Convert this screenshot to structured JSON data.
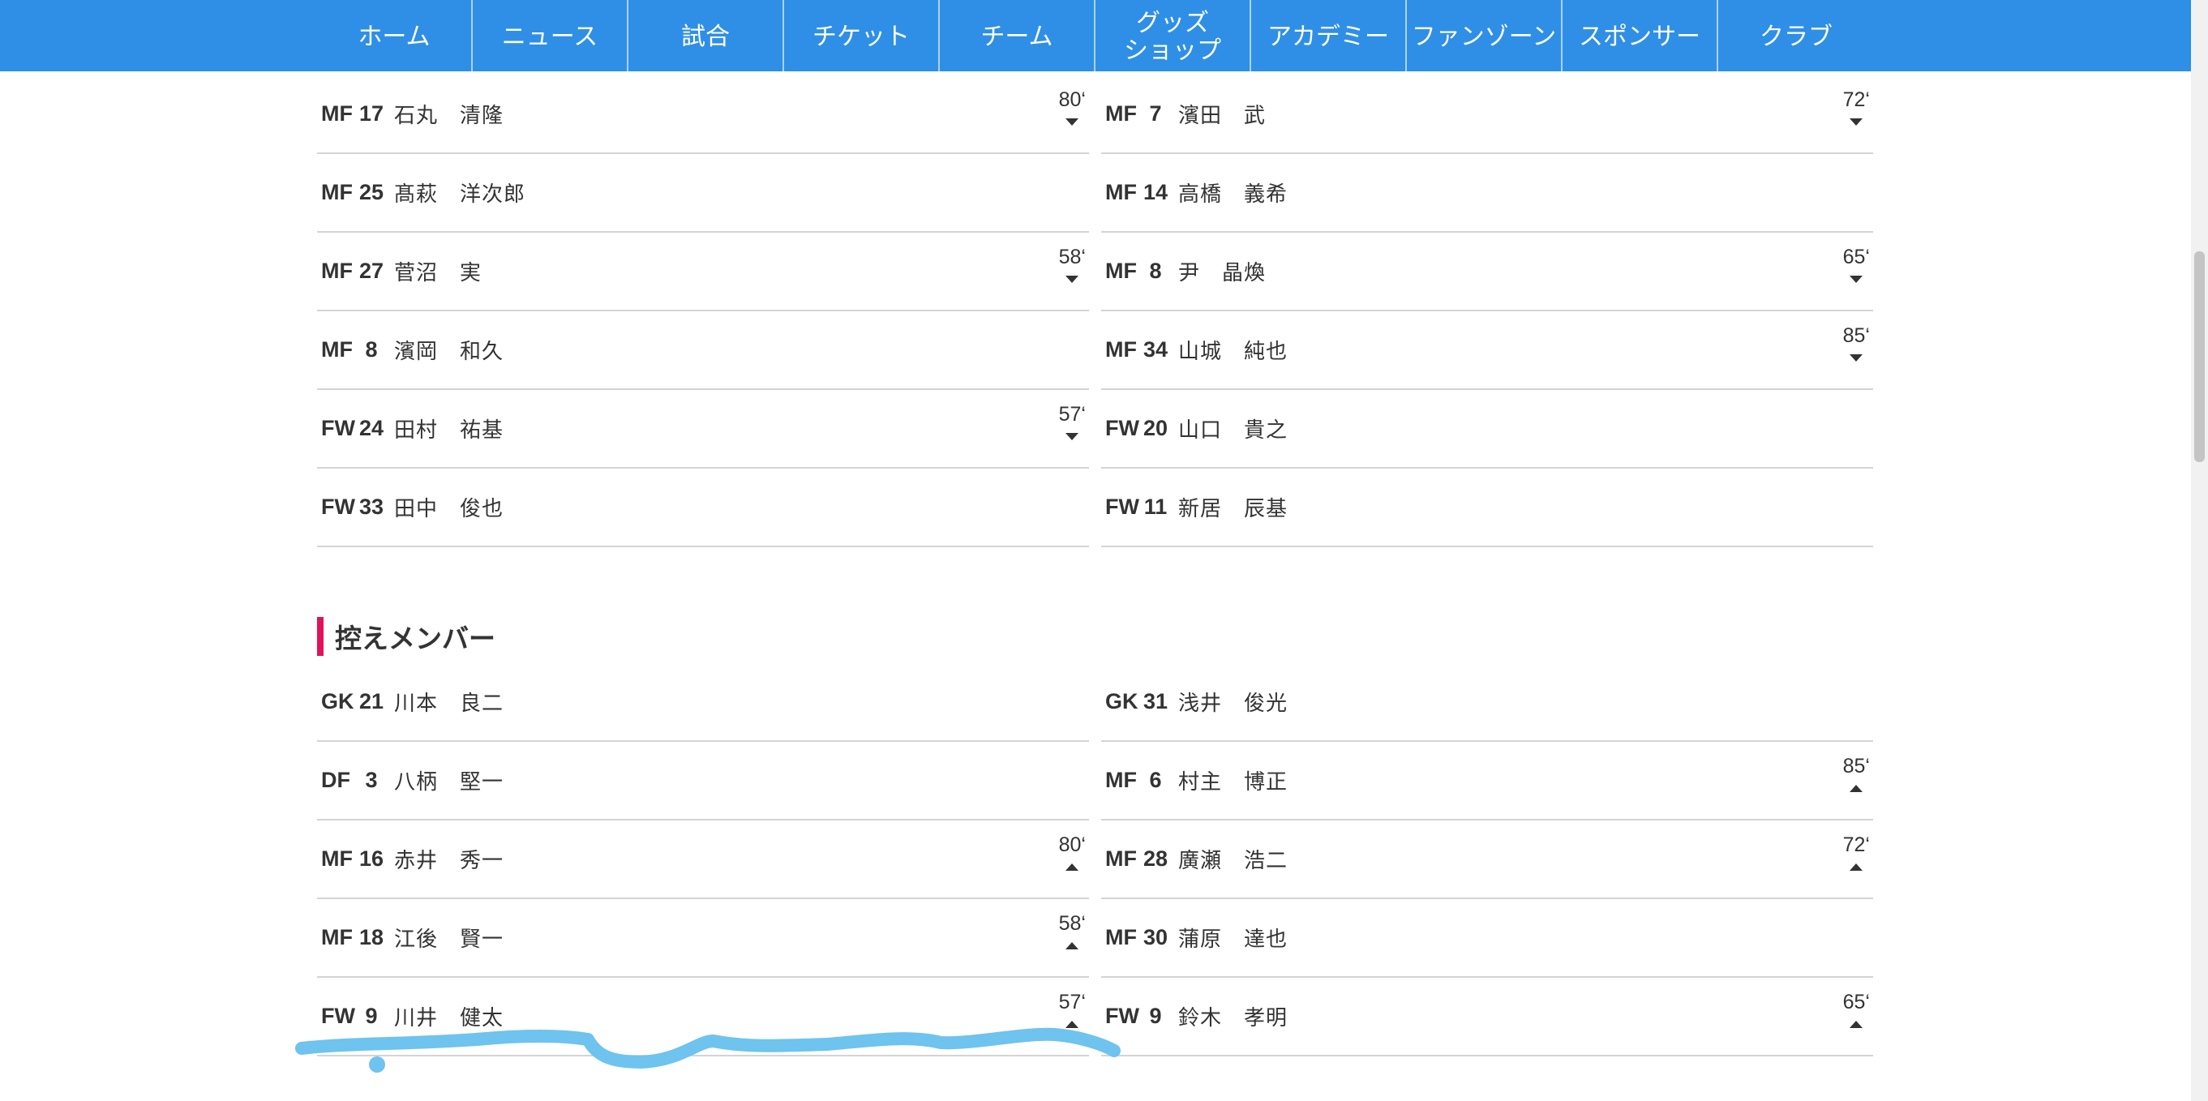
{
  "nav": {
    "items": [
      {
        "label": "ホーム"
      },
      {
        "label": "ニュース"
      },
      {
        "label": "試合"
      },
      {
        "label": "チケット"
      },
      {
        "label": "チーム"
      },
      {
        "label_line1": "グッズ",
        "label_line2": "ショップ"
      },
      {
        "label": "アカデミー"
      },
      {
        "label": "ファンゾーン"
      },
      {
        "label": "スポンサー"
      },
      {
        "label": "クラブ"
      }
    ]
  },
  "starters": {
    "left": [
      {
        "pos": "MF",
        "num": "17",
        "name": "石丸　清隆",
        "time": "80‘",
        "dir": "down"
      },
      {
        "pos": "MF",
        "num": "25",
        "name": "髙萩　洋次郎"
      },
      {
        "pos": "MF",
        "num": "27",
        "name": "菅沼　実",
        "time": "58‘",
        "dir": "down"
      },
      {
        "pos": "MF",
        "num": "8",
        "name": "濱岡　和久"
      },
      {
        "pos": "FW",
        "num": "24",
        "name": "田村　祐基",
        "time": "57‘",
        "dir": "down"
      },
      {
        "pos": "FW",
        "num": "33",
        "name": "田中　俊也"
      }
    ],
    "right": [
      {
        "pos": "MF",
        "num": "7",
        "name": "濱田　武",
        "time": "72‘",
        "dir": "down"
      },
      {
        "pos": "MF",
        "num": "14",
        "name": "高橋　義希"
      },
      {
        "pos": "MF",
        "num": "8",
        "name": "尹　晶煥",
        "time": "65‘",
        "dir": "down"
      },
      {
        "pos": "MF",
        "num": "34",
        "name": "山城　純也",
        "time": "85‘",
        "dir": "down"
      },
      {
        "pos": "FW",
        "num": "20",
        "name": "山口　貴之"
      },
      {
        "pos": "FW",
        "num": "11",
        "name": "新居　辰基"
      }
    ]
  },
  "subs_title": "控えメンバー",
  "subs": {
    "left": [
      {
        "pos": "GK",
        "num": "21",
        "name": "川本　良二"
      },
      {
        "pos": "DF",
        "num": "3",
        "name": "八柄　堅一"
      },
      {
        "pos": "MF",
        "num": "16",
        "name": "赤井　秀一",
        "time": "80‘",
        "dir": "up"
      },
      {
        "pos": "MF",
        "num": "18",
        "name": "江後　賢一",
        "time": "58‘",
        "dir": "up"
      },
      {
        "pos": "FW",
        "num": "9",
        "name": "川井　健太",
        "time": "57‘",
        "dir": "up"
      }
    ],
    "right": [
      {
        "pos": "GK",
        "num": "31",
        "name": "浅井　俊光"
      },
      {
        "pos": "MF",
        "num": "6",
        "name": "村主　博正",
        "time": "85‘",
        "dir": "up"
      },
      {
        "pos": "MF",
        "num": "28",
        "name": "廣瀬　浩二",
        "time": "72‘",
        "dir": "up"
      },
      {
        "pos": "MF",
        "num": "30",
        "name": "蒲原　達也"
      },
      {
        "pos": "FW",
        "num": "9",
        "name": "鈴木　孝明",
        "time": "65‘",
        "dir": "up"
      }
    ]
  },
  "colors": {
    "nav_bg": "#2f8fe6",
    "section_accent": "#e0135a",
    "annotation": "#6ec3ef"
  }
}
